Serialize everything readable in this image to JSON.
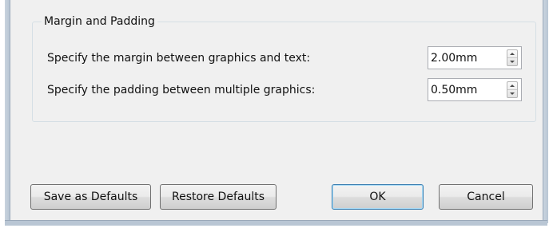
{
  "group": {
    "title": "Margin and Padding"
  },
  "settings": [
    {
      "label": "Specify the margin between graphics and text:",
      "value": "2.00mm"
    },
    {
      "label": "Specify the padding between multiple graphics:",
      "value": "0.50mm"
    }
  ],
  "buttons": {
    "save_defaults": "Save as Defaults",
    "restore_defaults": "Restore Defaults",
    "ok": "OK",
    "cancel": "Cancel"
  },
  "icons": {
    "spin_up": "chevron-up-icon",
    "spin_down": "chevron-down-icon"
  },
  "colors": {
    "dialog_background": "#f0f0f0",
    "default_button_border": "#3c7fb1"
  }
}
